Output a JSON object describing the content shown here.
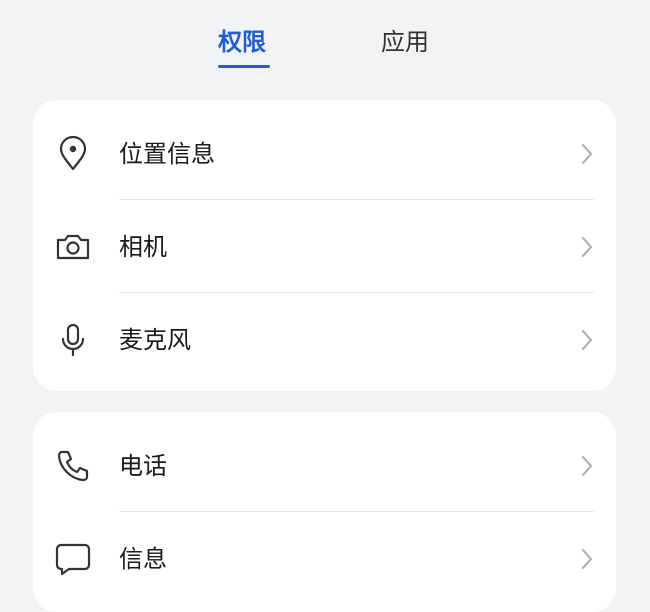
{
  "tabs": {
    "permissions": "权限",
    "apps": "应用",
    "active": "permissions"
  },
  "groups": [
    {
      "items": [
        {
          "label": "位置信息",
          "icon": "location-pin-icon"
        },
        {
          "label": "相机",
          "icon": "camera-icon"
        },
        {
          "label": "麦克风",
          "icon": "microphone-icon"
        }
      ]
    },
    {
      "items": [
        {
          "label": "电话",
          "icon": "phone-icon"
        },
        {
          "label": "信息",
          "icon": "message-icon"
        }
      ]
    }
  ],
  "colors": {
    "accent": "#1f5fd1",
    "background": "#f1f3f5",
    "card": "#ffffff",
    "icon": "#333333",
    "chevron": "#a6a9ad"
  }
}
